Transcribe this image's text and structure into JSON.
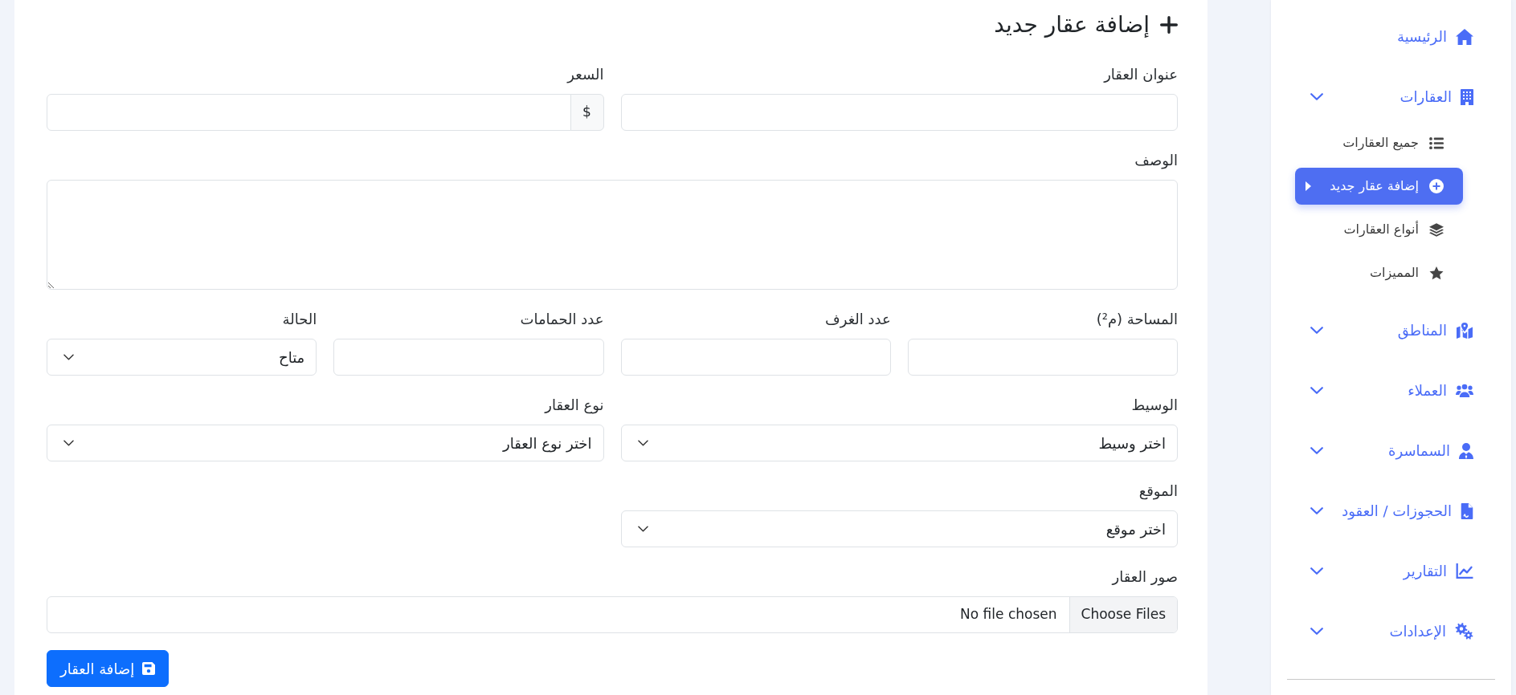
{
  "sidebar": {
    "items": [
      {
        "kind": "link",
        "label": "الرئيسية",
        "selected": false
      },
      {
        "kind": "group",
        "label": "العقارات",
        "selected": false,
        "children": [
          {
            "label": "جميع العقارات",
            "selected": false
          },
          {
            "label": "إضافة عقار جديد",
            "selected": true
          },
          {
            "label": "أنواع العقارات",
            "selected": false
          },
          {
            "label": "المميزات",
            "selected": false
          }
        ]
      },
      {
        "kind": "group",
        "label": "المناطق",
        "selected": false
      },
      {
        "kind": "group",
        "label": "العملاء",
        "selected": false
      },
      {
        "kind": "group",
        "label": "السماسرة",
        "selected": false
      },
      {
        "kind": "group",
        "label": "الحجوزات / العقود",
        "selected": false
      },
      {
        "kind": "group",
        "label": "التقارير",
        "selected": false
      },
      {
        "kind": "group",
        "label": "الإعدادات",
        "selected": false
      }
    ]
  },
  "form": {
    "title": "إضافة عقار جديد",
    "rows": [
      [
        {
          "kind": "text",
          "label": "عنوان العقار"
        },
        {
          "kind": "price",
          "label": "السعر",
          "addon": "$"
        }
      ],
      [
        {
          "kind": "textarea",
          "label": "الوصف"
        }
      ],
      [
        {
          "kind": "text",
          "label": "المساحة (م²)"
        },
        {
          "kind": "text",
          "label": "عدد الغرف"
        },
        {
          "kind": "text",
          "label": "عدد الحمامات"
        },
        {
          "kind": "select",
          "label": "الحالة",
          "value": "متاح"
        }
      ],
      [
        {
          "kind": "select",
          "label": "الوسيط",
          "value": "اختر وسيط"
        },
        {
          "kind": "select",
          "label": "نوع العقار",
          "value": "اختر نوع العقار"
        }
      ],
      [
        {
          "kind": "select",
          "label": "الموقع",
          "value": "اختر موقع"
        }
      ],
      [
        {
          "kind": "file",
          "label": "صور العقار",
          "button": "Choose Files",
          "status": "No file chosen"
        }
      ]
    ],
    "submit": {
      "label": "إضافة العقار"
    }
  }
}
